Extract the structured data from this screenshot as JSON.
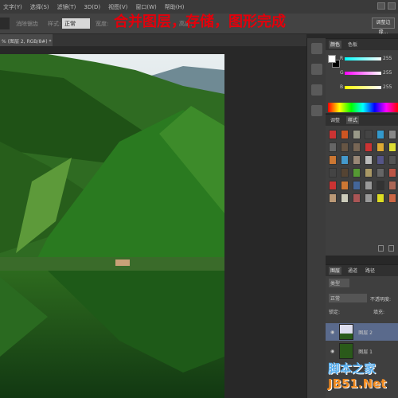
{
  "menu": [
    "文字(Y)",
    "选择(S)",
    "滤镜(T)",
    "3D(D)",
    "视图(V)",
    "窗口(W)",
    "帮助(H)"
  ],
  "options": {
    "antialias": "消除锯齿",
    "style_label": "样式:",
    "style_value": "正常",
    "width_label": "宽度:",
    "height_label": "高度:",
    "refine_edge": "调整边缘..."
  },
  "overlay_text": "合并图层，存储，图形完成",
  "document_tab": "% (图层 2, RGB/8#) *",
  "color_panel": {
    "tabs": [
      "颜色",
      "色板"
    ],
    "channels": [
      {
        "label": "R",
        "value": "255"
      },
      {
        "label": "G",
        "value": "255"
      },
      {
        "label": "B",
        "value": "255"
      }
    ]
  },
  "styles_panel": {
    "tabs": [
      "调整",
      "样式"
    ],
    "swatches": [
      "#c33",
      "#c52",
      "#998",
      "#444",
      "#39c",
      "#888",
      "#666",
      "#654",
      "#765",
      "#c33",
      "#da3",
      "#dd3",
      "#c73",
      "#49c",
      "#987",
      "#bbb",
      "#558",
      "#555",
      "#444",
      "#543",
      "#593",
      "#a96",
      "#666",
      "#b54",
      "#c33",
      "#c73",
      "#469",
      "#999",
      "#333",
      "#a65",
      "#b97",
      "#ccb",
      "#a55",
      "#999",
      "#dd2",
      "#c64"
    ]
  },
  "layers_panel": {
    "tabs": [
      "图层",
      "通道",
      "路径"
    ],
    "filter": "类型",
    "blend_mode": "正常",
    "opacity_label": "不透明度:",
    "lock_label": "锁定:",
    "fill_label": "填充:",
    "layers": [
      {
        "name": "图层 2",
        "selected": true
      },
      {
        "name": "图层 1",
        "selected": false
      }
    ]
  },
  "watermark": {
    "line1": "脚本之家",
    "line2": "JB51.Net"
  }
}
